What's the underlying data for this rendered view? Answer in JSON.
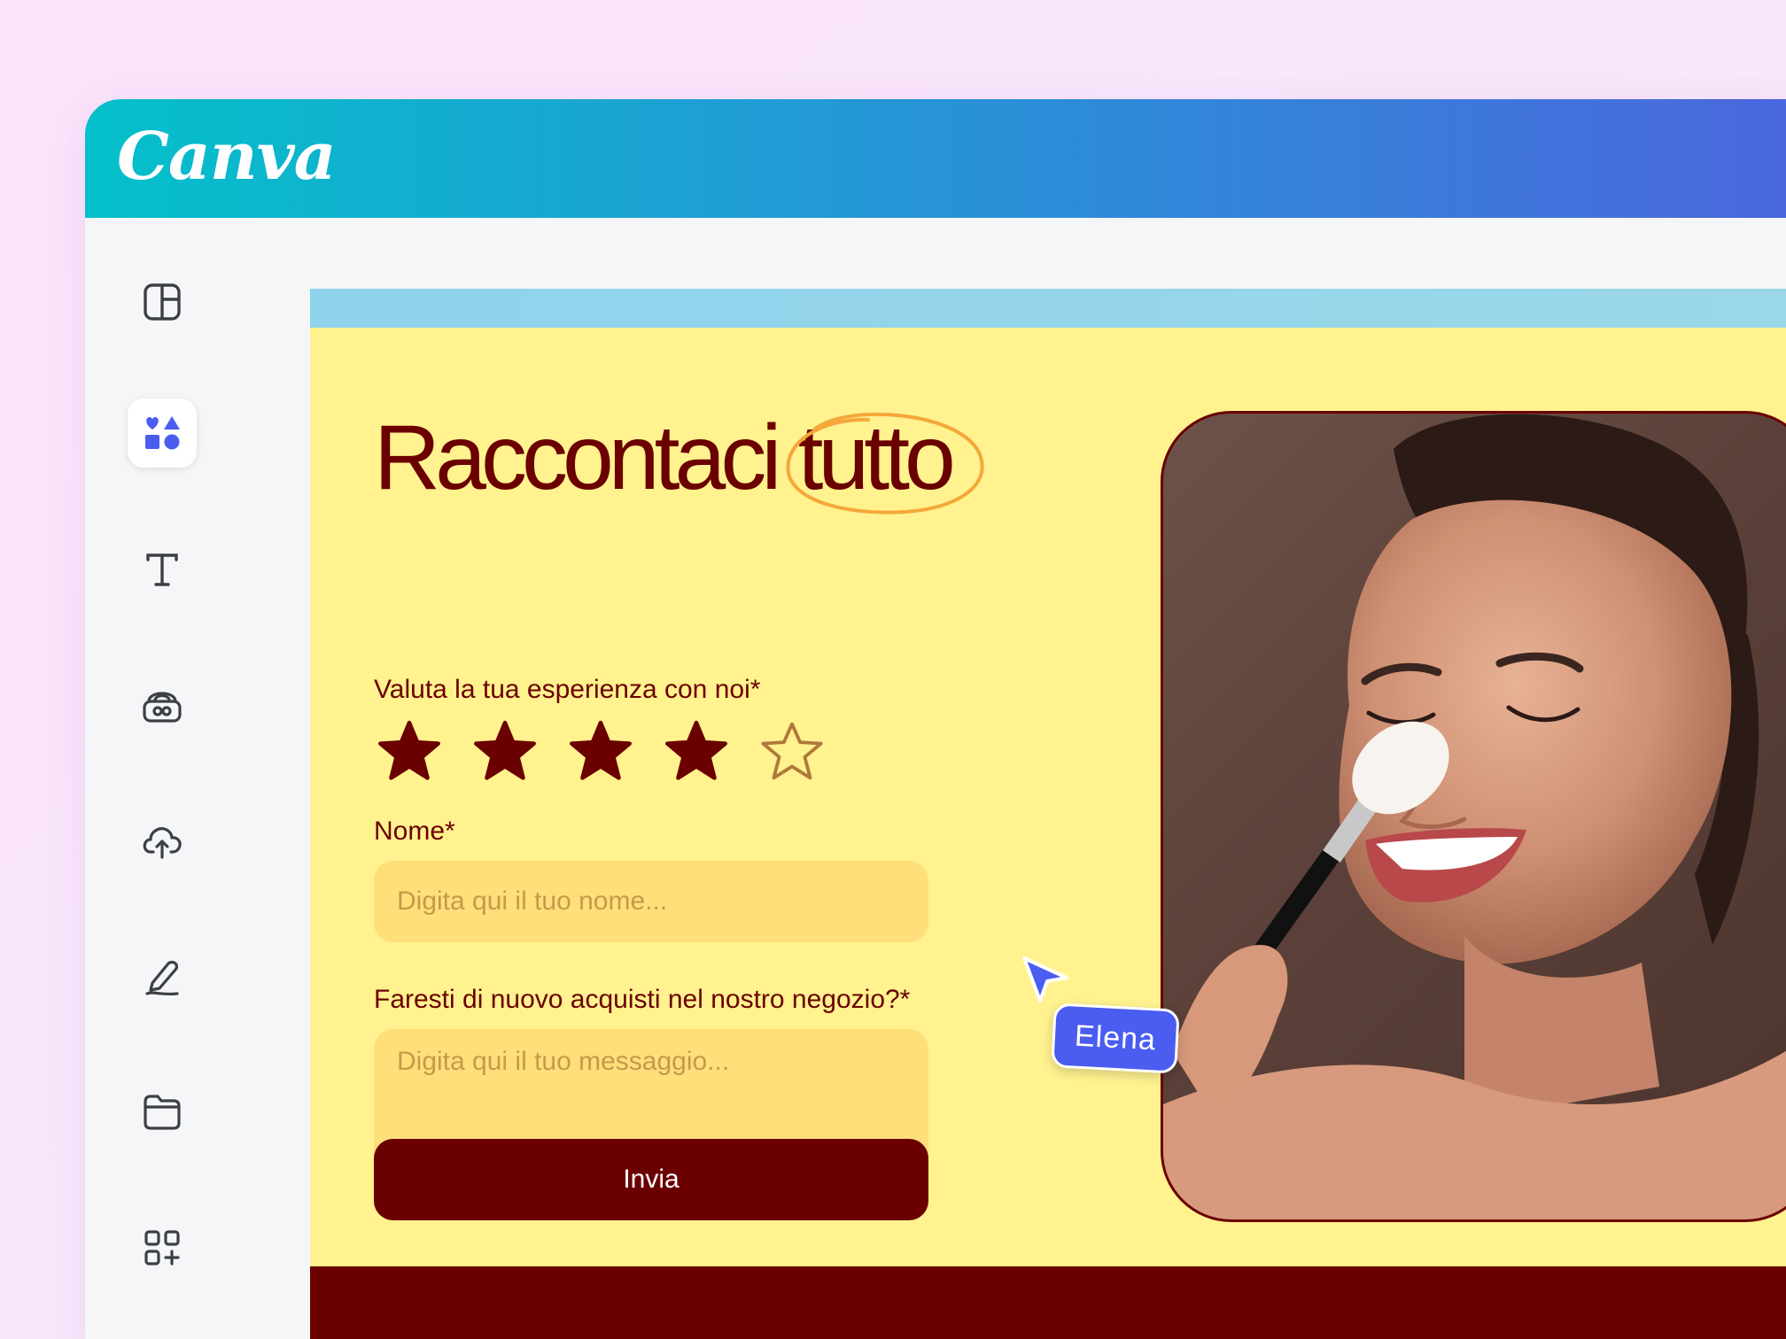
{
  "app": {
    "logo_text": "Canva"
  },
  "sidebar": {
    "items": [
      {
        "name": "design",
        "icon": "layout-icon"
      },
      {
        "name": "elements",
        "icon": "shapes-icon",
        "active": true
      },
      {
        "name": "text",
        "icon": "text-icon"
      },
      {
        "name": "brand",
        "icon": "brand-kit-icon"
      },
      {
        "name": "uploads",
        "icon": "cloud-upload-icon"
      },
      {
        "name": "draw",
        "icon": "pen-draw-icon"
      },
      {
        "name": "projects",
        "icon": "folder-icon"
      },
      {
        "name": "apps",
        "icon": "apps-grid-icon"
      }
    ]
  },
  "form": {
    "title_word1": "Raccontaci",
    "title_word2": "tutto",
    "rating_label": "Valuta la tua esperienza con noi*",
    "rating": {
      "value": 4,
      "max": 5
    },
    "name_label": "Nome*",
    "name_placeholder": "Digita qui il tuo nome...",
    "name_value": "",
    "question_label": "Faresti di nuovo acquisti nel nostro negozio?*",
    "message_placeholder": "Digita qui il tuo messaggio...",
    "message_value": "",
    "submit_label": "Invia"
  },
  "collaborator": {
    "name": "Elena",
    "color": "#4a5df0"
  },
  "colors": {
    "canvas_bg": "#fff28f",
    "brand_dark": "#6b0000",
    "input_bg": "#ffdf7a",
    "accent_orange": "#f5a73a",
    "topbar_start": "#04c0ca",
    "topbar_end": "#4a67dd"
  }
}
